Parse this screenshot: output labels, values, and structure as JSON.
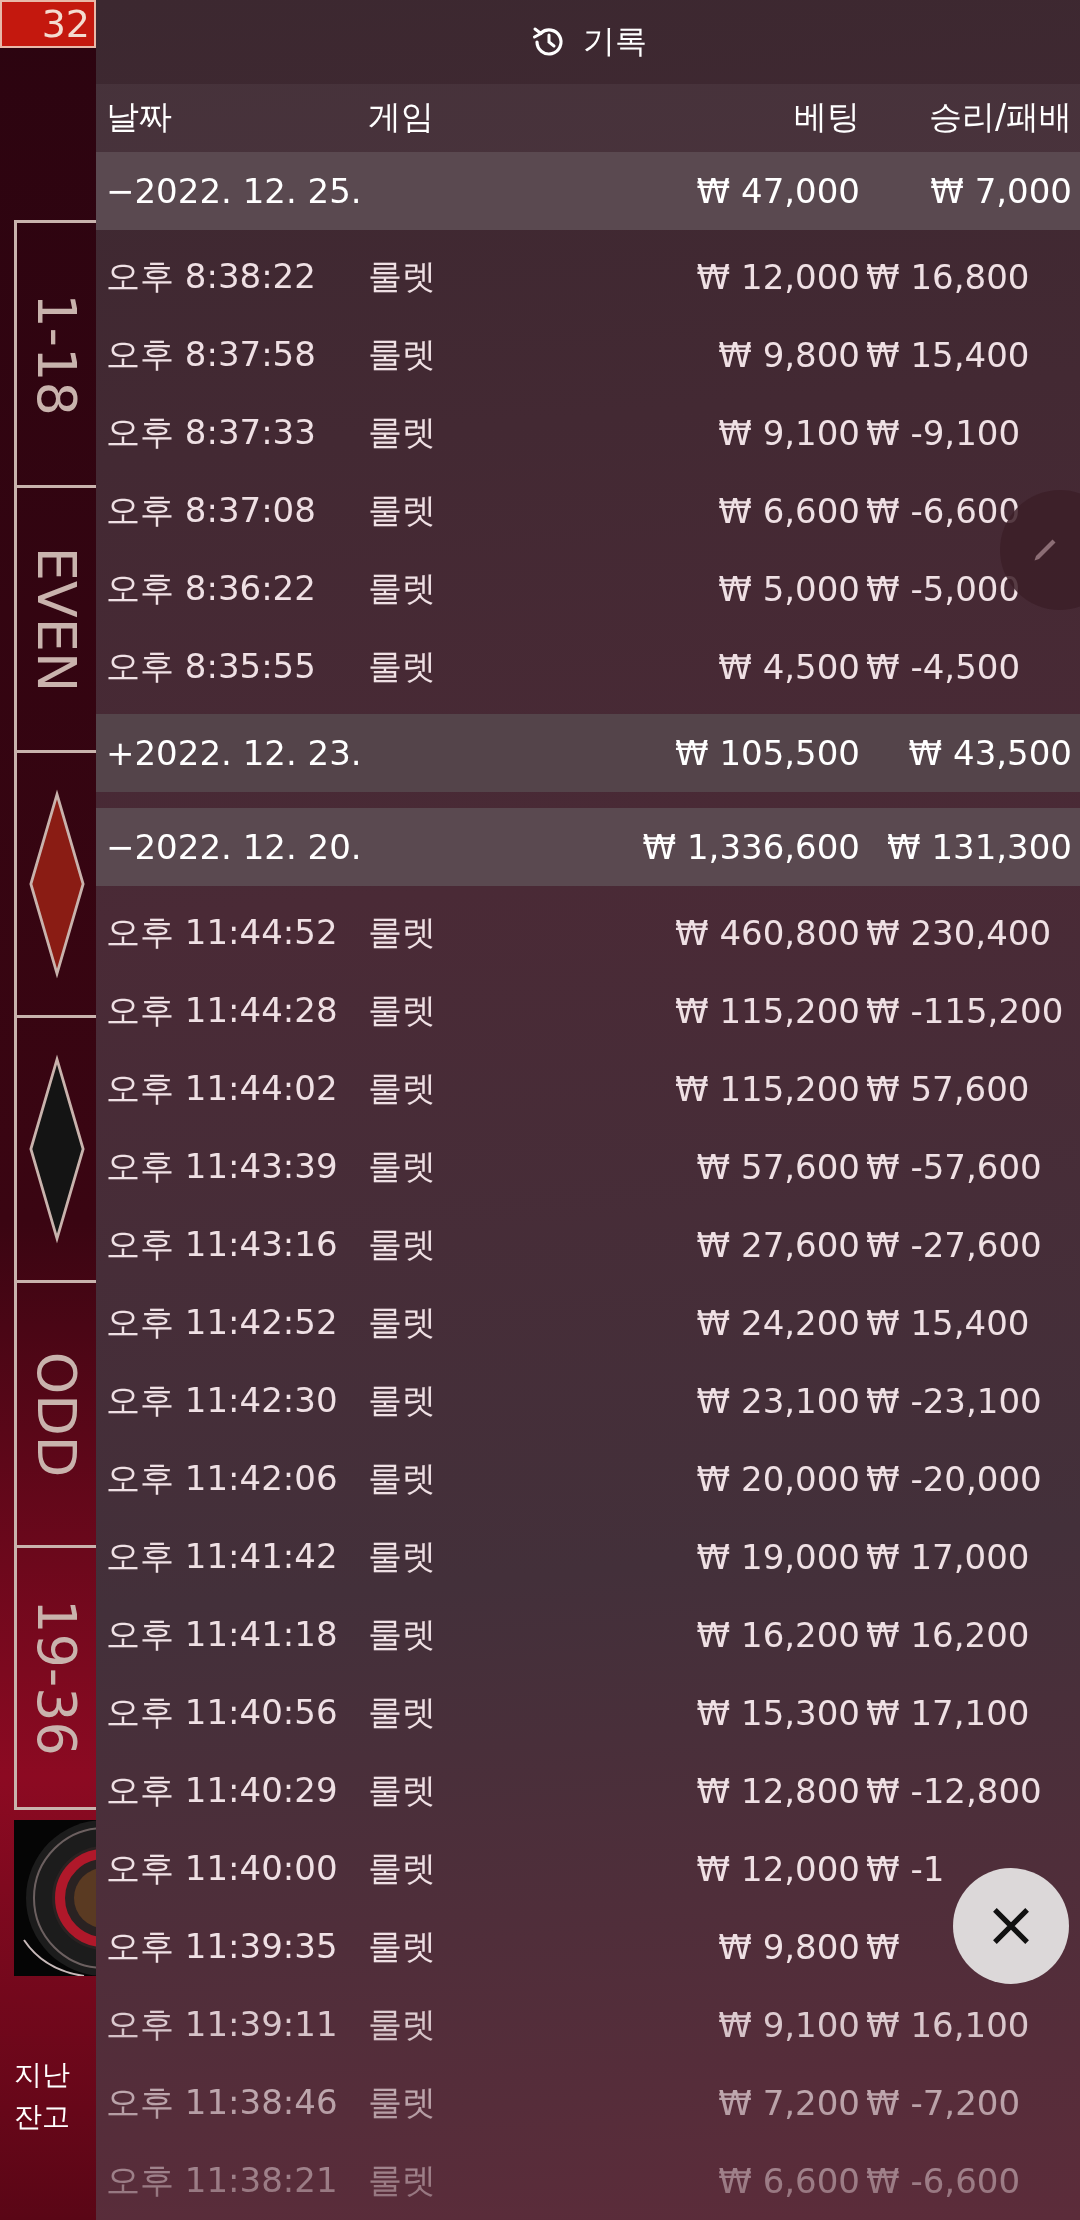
{
  "background": {
    "number_badge": "32",
    "bet_cells": [
      {
        "kind": "text",
        "label": "1-18"
      },
      {
        "kind": "text",
        "label": "EVEN"
      },
      {
        "kind": "diamond",
        "color": "#8a1c14"
      },
      {
        "kind": "diamond",
        "color": "#141414"
      },
      {
        "kind": "text",
        "label": "ODD"
      },
      {
        "kind": "text",
        "label": "19-36"
      }
    ],
    "wheel": {
      "kind": "picture"
    },
    "info_lines": [
      "지난",
      "잔고"
    ]
  },
  "panel": {
    "title": "기록",
    "columns": [
      "날짜",
      "게임",
      "베팅",
      "승리/패배"
    ],
    "groups": [
      {
        "label": "−2022. 12. 25.",
        "bet": "₩ 47,000",
        "result": "₩ 7,000",
        "expanded": true,
        "rows": [
          {
            "time": "오후 8:38:22",
            "game": "룰렛",
            "bet": "₩ 12,000",
            "result": "₩ 16,800"
          },
          {
            "time": "오후 8:37:58",
            "game": "룰렛",
            "bet": "₩ 9,800",
            "result": "₩ 15,400"
          },
          {
            "time": "오후 8:37:33",
            "game": "룰렛",
            "bet": "₩ 9,100",
            "result": "₩ -9,100"
          },
          {
            "time": "오후 8:37:08",
            "game": "룰렛",
            "bet": "₩ 6,600",
            "result": "₩ -6,600"
          },
          {
            "time": "오후 8:36:22",
            "game": "룰렛",
            "bet": "₩ 5,000",
            "result": "₩ -5,000"
          },
          {
            "time": "오후 8:35:55",
            "game": "룰렛",
            "bet": "₩ 4,500",
            "result": "₩ -4,500"
          }
        ]
      },
      {
        "label": "+2022. 12. 23.",
        "bet": "₩ 105,500",
        "result": "₩ 43,500",
        "expanded": false
      },
      {
        "label": "−2022. 12. 20.",
        "bet": "₩ 1,336,600",
        "result": "₩ 131,300",
        "expanded": true,
        "rows": [
          {
            "time": "오후 11:44:52",
            "game": "룰렛",
            "bet": "₩ 460,800",
            "result": "₩ 230,400"
          },
          {
            "time": "오후 11:44:28",
            "game": "룰렛",
            "bet": "₩ 115,200",
            "result": "₩ -115,200"
          },
          {
            "time": "오후 11:44:02",
            "game": "룰렛",
            "bet": "₩ 115,200",
            "result": "₩ 57,600"
          },
          {
            "time": "오후 11:43:39",
            "game": "룰렛",
            "bet": "₩ 57,600",
            "result": "₩ -57,600"
          },
          {
            "time": "오후 11:43:16",
            "game": "룰렛",
            "bet": "₩ 27,600",
            "result": "₩ -27,600"
          },
          {
            "time": "오후 11:42:52",
            "game": "룰렛",
            "bet": "₩ 24,200",
            "result": "₩ 15,400"
          },
          {
            "time": "오후 11:42:30",
            "game": "룰렛",
            "bet": "₩ 23,100",
            "result": "₩ -23,100"
          },
          {
            "time": "오후 11:42:06",
            "game": "룰렛",
            "bet": "₩ 20,000",
            "result": "₩ -20,000"
          },
          {
            "time": "오후 11:41:42",
            "game": "룰렛",
            "bet": "₩ 19,000",
            "result": "₩ 17,000"
          },
          {
            "time": "오후 11:41:18",
            "game": "룰렛",
            "bet": "₩ 16,200",
            "result": "₩ 16,200"
          },
          {
            "time": "오후 11:40:56",
            "game": "룰렛",
            "bet": "₩ 15,300",
            "result": "₩ 17,100"
          },
          {
            "time": "오후 11:40:29",
            "game": "룰렛",
            "bet": "₩ 12,800",
            "result": "₩ -12,800"
          },
          {
            "time": "오후 11:40:00",
            "game": "룰렛",
            "bet": "₩ 12,000",
            "result": "₩ -1"
          },
          {
            "time": "오후 11:39:35",
            "game": "룰렛",
            "bet": "₩ 9,800",
            "result": "₩"
          },
          {
            "time": "오후 11:39:11",
            "game": "룰렛",
            "bet": "₩ 9,100",
            "result": "₩ 16,100"
          },
          {
            "time": "오후 11:38:46",
            "game": "룰렛",
            "bet": "₩ 7,200",
            "result": "₩ -7,200"
          },
          {
            "time": "오후 11:38:21",
            "game": "룰렛",
            "bet": "₩ 6,600",
            "result": "₩ -6,600"
          }
        ]
      }
    ]
  }
}
